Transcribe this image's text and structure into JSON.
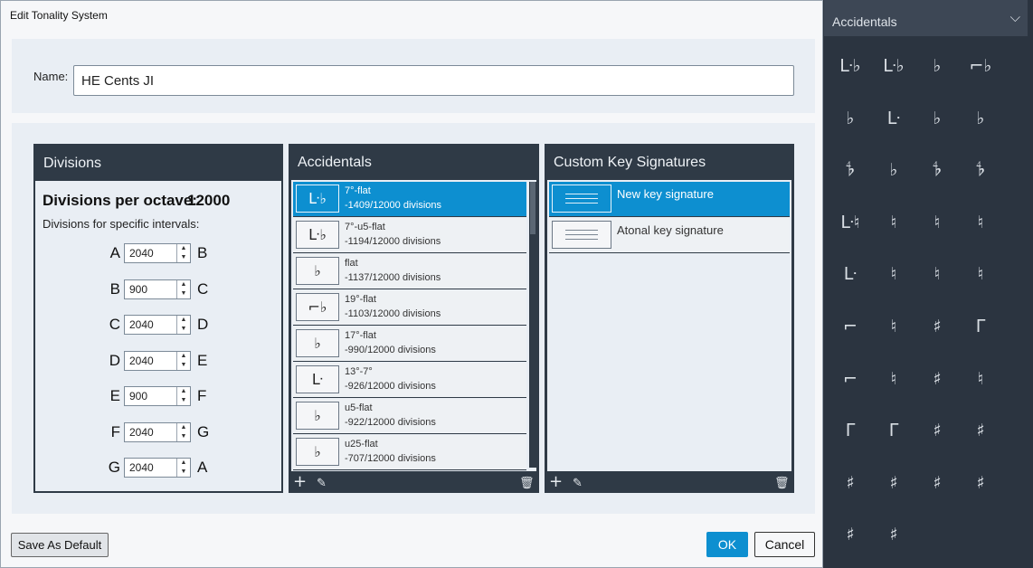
{
  "dialog": {
    "title": "Edit Tonality System",
    "name_label": "Name:",
    "name_value": "HE Cents JI"
  },
  "divisions": {
    "title": "Divisions",
    "per_octave_label": "Divisions per octave:",
    "per_octave_value": "12000",
    "specific_label": "Divisions for specific intervals:",
    "intervals": [
      {
        "from": "A",
        "value": "2040",
        "to": "B"
      },
      {
        "from": "B",
        "value": "900",
        "to": "C"
      },
      {
        "from": "C",
        "value": "2040",
        "to": "D"
      },
      {
        "from": "D",
        "value": "2040",
        "to": "E"
      },
      {
        "from": "E",
        "value": "900",
        "to": "F"
      },
      {
        "from": "F",
        "value": "2040",
        "to": "G"
      },
      {
        "from": "G",
        "value": "2040",
        "to": "A"
      }
    ]
  },
  "accidentals": {
    "title": "Accidentals",
    "items": [
      {
        "icon": "7-flat-icon",
        "glyph": "ᒷ♭",
        "name": "7°-flat",
        "divisions": "-1409/12000 divisions",
        "selected": true
      },
      {
        "icon": "7-u5-flat-icon",
        "glyph": "ᒷ♭",
        "name": "7°-u5-flat",
        "divisions": "-1194/12000 divisions",
        "selected": false
      },
      {
        "icon": "flat-icon",
        "glyph": "♭",
        "name": "flat",
        "divisions": "-1137/12000 divisions",
        "selected": false
      },
      {
        "icon": "19-flat-icon",
        "glyph": "⌐♭",
        "name": "19°-flat",
        "divisions": "-1103/12000 divisions",
        "selected": false
      },
      {
        "icon": "17-flat-icon",
        "glyph": "♭",
        "name": "17°-flat",
        "divisions": "-990/12000 divisions",
        "selected": false
      },
      {
        "icon": "13-7-icon",
        "glyph": "ᒷ",
        "name": "13°-7°",
        "divisions": "-926/12000 divisions",
        "selected": false
      },
      {
        "icon": "u5-flat-icon",
        "glyph": "♭",
        "name": "u5-flat",
        "divisions": "-922/12000 divisions",
        "selected": false
      },
      {
        "icon": "u25-flat-icon",
        "glyph": "♭",
        "name": "u25-flat",
        "divisions": "-707/12000 divisions",
        "selected": false
      }
    ]
  },
  "key_signatures": {
    "title": "Custom Key Signatures",
    "items": [
      {
        "name": "New key signature",
        "selected": true
      },
      {
        "name": "Atonal key signature",
        "selected": false
      }
    ]
  },
  "toolbar": {
    "add": "+",
    "edit": "✎",
    "delete": "🗑"
  },
  "buttons": {
    "save_default": "Save As Default",
    "ok": "OK",
    "cancel": "Cancel"
  },
  "sidebar": {
    "title": "Accidentals",
    "chevron": "⌵",
    "glyphs": [
      "ᒷ♭",
      "ᒷ♭",
      "♭",
      "⌐♭",
      "♭",
      "ᒷ",
      "♭",
      "♭",
      "𝄳",
      "♭",
      "𝄳",
      "𝄳",
      "ᒷ♮",
      "♮",
      "♮",
      "♮",
      "ᒷ",
      "♮",
      "♮",
      "♮",
      "⌐",
      "♮",
      "♯",
      "ᒥ",
      "⌐",
      "♮",
      "♯",
      "♮",
      "ᒥ",
      "ᒥ",
      "♯",
      "♯",
      "♯",
      "♯",
      "♯",
      "♯",
      "♯",
      "♯"
    ]
  },
  "colors": {
    "accent": "#0d8fd0",
    "panel": "#2f3a46",
    "sidebar": "#2b3440"
  }
}
